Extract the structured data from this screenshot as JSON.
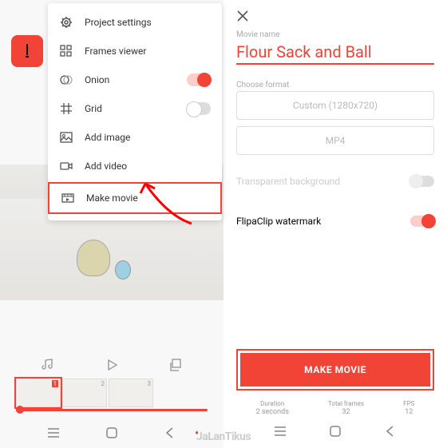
{
  "menu": {
    "project_settings": "Project settings",
    "frames_viewer": "Frames viewer",
    "onion": "Onion",
    "grid": "Grid",
    "add_image": "Add image",
    "add_video": "Add video",
    "make_movie": "Make movie"
  },
  "timeline": {
    "frames": [
      "1",
      "2",
      "3"
    ]
  },
  "right": {
    "movie_name_label": "Movie name",
    "movie_name_value": "Flour Sack and Ball",
    "choose_format_label": "Choose format",
    "resolution": "Custom (1280x720)",
    "codec": "MP4",
    "transparent_bg": "Transparent background",
    "watermark": "FlipaClip watermark",
    "make_button": "MAKE MOVIE",
    "stats": {
      "duration_label": "Duration",
      "duration_value": "2 seconds",
      "frames_label": "Total frames",
      "frames_value": "32",
      "fps_label": "FPS",
      "fps_value": "12"
    }
  },
  "brand": "JalanTikus"
}
